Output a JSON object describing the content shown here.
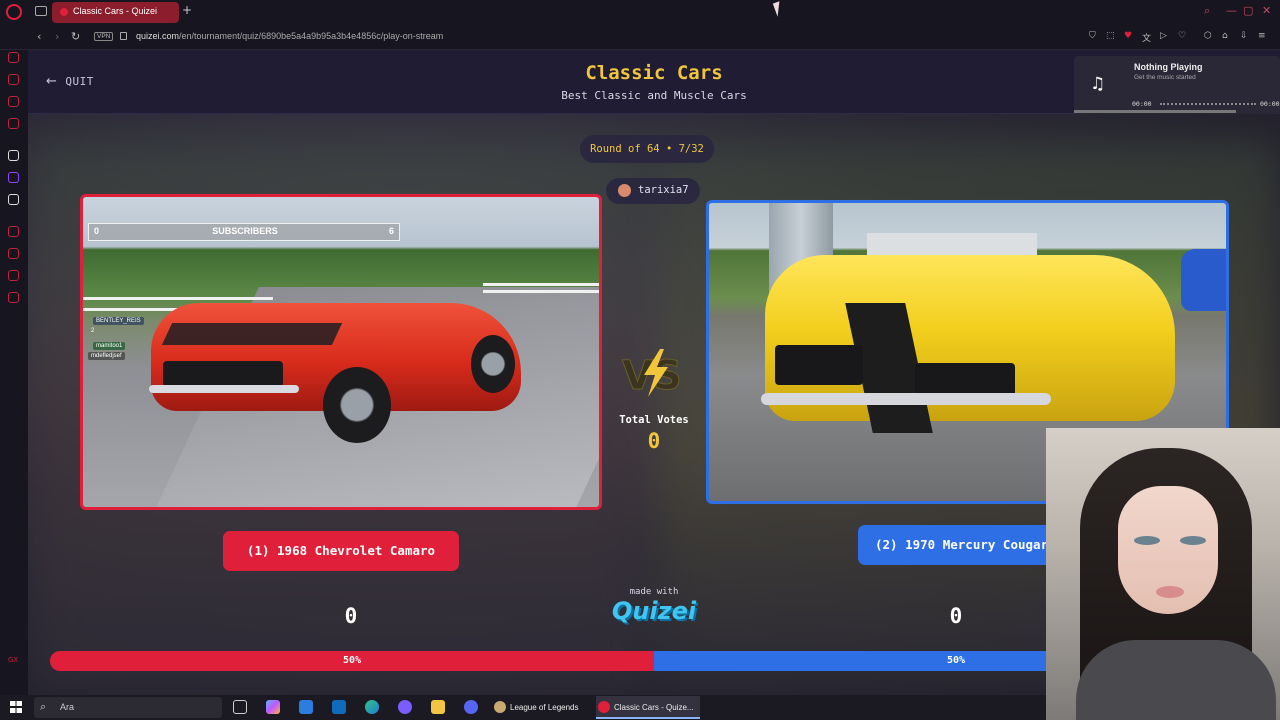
{
  "browser": {
    "tab_title": "Classic Cars - Quizei",
    "url_domain": "quizei.com",
    "url_path": "/en/tournament/quiz/6890be5a4a9b95a3b4e4856c/play-on-stream",
    "vpn_label": "VPN",
    "sidebar_badge": "GX"
  },
  "header": {
    "quit_label": "QUIT",
    "title": "Classic Cars",
    "subtitle": "Best Classic and Muscle Cars"
  },
  "music": {
    "title": "Nothing Playing",
    "subtitle": "Get the music started",
    "time_current": "00:00",
    "time_total": "00:00"
  },
  "round": {
    "label": "Round of 64 • 7/32",
    "streamer": "tarixia7"
  },
  "left": {
    "label": "(1) 1968 Chevrolet Camaro",
    "score": "0",
    "percent": "50%",
    "overlay_left": "0",
    "overlay_label": "SUBSCRIBERS",
    "overlay_right": "6",
    "chat": [
      "BENTLEY_REIS",
      "2",
      "mamitoo1",
      "mdefledjsef"
    ]
  },
  "right": {
    "label": "(2) 1970 Mercury Cougar",
    "score": "0",
    "percent": "50%"
  },
  "center": {
    "total_votes_label": "Total Votes",
    "total_votes_value": "0",
    "made_with": "made with",
    "brand": "Quizei"
  },
  "taskbar": {
    "search_placeholder": "Ara",
    "apps": [
      "League of Legends",
      "Classic Cars - Quize..."
    ]
  },
  "colors": {
    "accent_red": "#e0203a",
    "accent_blue": "#2e6fe6",
    "title_yellow": "#f2c63a",
    "brand_cyan": "#3fc5f0"
  }
}
